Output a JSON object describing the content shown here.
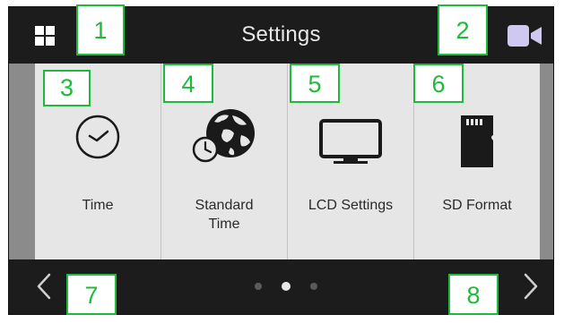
{
  "header": {
    "title": "Settings",
    "left_icon": "grid-icon",
    "right_icon": "video-camera-icon"
  },
  "tiles": [
    {
      "label": "Time",
      "icon": "clock-icon"
    },
    {
      "label": "Standard\nTime",
      "icon": "globe-clock-icon"
    },
    {
      "label": "LCD Settings",
      "icon": "monitor-icon"
    },
    {
      "label": "SD Format",
      "icon": "sd-card-icon"
    }
  ],
  "footer": {
    "prev_icon": "chevron-left-icon",
    "next_icon": "chevron-right-icon",
    "page_count": 3,
    "current_page": 2
  },
  "callouts": [
    "1",
    "2",
    "3",
    "4",
    "5",
    "6",
    "7",
    "8"
  ],
  "colors": {
    "screen_bg": "#1c1c1c",
    "tile_bg": "#e6e6e6",
    "side_bar": "#8b8b8b",
    "callout": "#1fba3a"
  }
}
